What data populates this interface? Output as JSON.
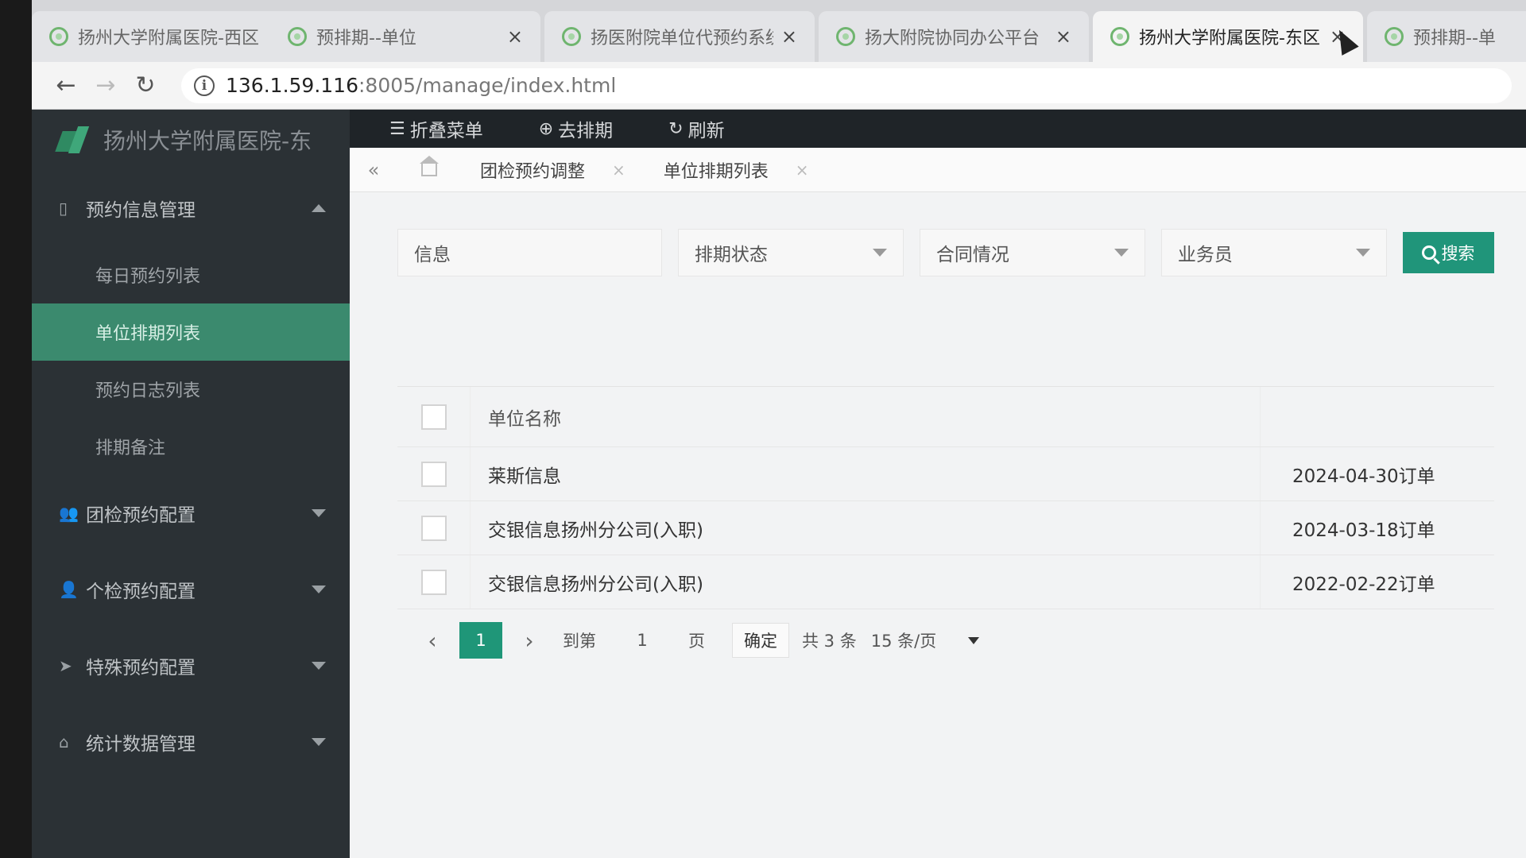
{
  "browser": {
    "tabs": [
      {
        "title": "扬州大学附属医院-西区:",
        "active": false
      },
      {
        "title": "预排期--单位",
        "active": false
      },
      {
        "title": "扬医附院单位代预约系统",
        "active": false
      },
      {
        "title": "扬大附院协同办公平台",
        "active": false
      },
      {
        "title": "扬州大学附属医院-东区:",
        "active": true
      },
      {
        "title": "预排期--单",
        "active": false
      }
    ],
    "tab_close": "×",
    "url_host": "136.1.59.116",
    "url_rest": ":8005/manage/index.html",
    "back": "←",
    "forward": "→",
    "reload": "↻"
  },
  "app": {
    "logo_text": "扬州大学附属医院-东",
    "toolbar": {
      "collapse_menu": "折叠菜单",
      "go_schedule": "去排期",
      "refresh": "刷新"
    },
    "sidebar": {
      "groups": [
        {
          "label": "预约信息管理",
          "icon": "tablet-icon",
          "expanded": true
        },
        {
          "label": "团检预约配置",
          "icon": "users-icon",
          "expanded": false
        },
        {
          "label": "个检预约配置",
          "icon": "user-icon",
          "expanded": false
        },
        {
          "label": "特殊预约配置",
          "icon": "send-icon",
          "expanded": false
        },
        {
          "label": "统计数据管理",
          "icon": "tag-icon",
          "expanded": false
        }
      ],
      "submenu": [
        {
          "label": "每日预约列表",
          "active": false
        },
        {
          "label": "单位排期列表",
          "active": true
        },
        {
          "label": "预约日志列表",
          "active": false
        },
        {
          "label": "排期备注",
          "active": false
        }
      ]
    },
    "page_tabs": [
      {
        "label": "团检预约调整"
      },
      {
        "label": "单位排期列表"
      }
    ],
    "filters": {
      "info_placeholder": "信息",
      "schedule_status": "排期状态",
      "contract_status": "合同情况",
      "salesperson": "业务员",
      "search_label": "搜索"
    },
    "table": {
      "header_name": "单位名称",
      "rows": [
        {
          "name": "莱斯信息",
          "date": "2024-04-30订单"
        },
        {
          "name": "交银信息扬州分公司(入职)",
          "date": "2024-03-18订单"
        },
        {
          "name": "交银信息扬州分公司(入职)",
          "date": "2022-02-22订单"
        }
      ]
    },
    "pagination": {
      "current_page": "1",
      "goto_label": "到第",
      "goto_value": "1",
      "page_unit": "页",
      "confirm": "确定",
      "total": "共 3 条",
      "page_size": "15 条/页"
    }
  }
}
